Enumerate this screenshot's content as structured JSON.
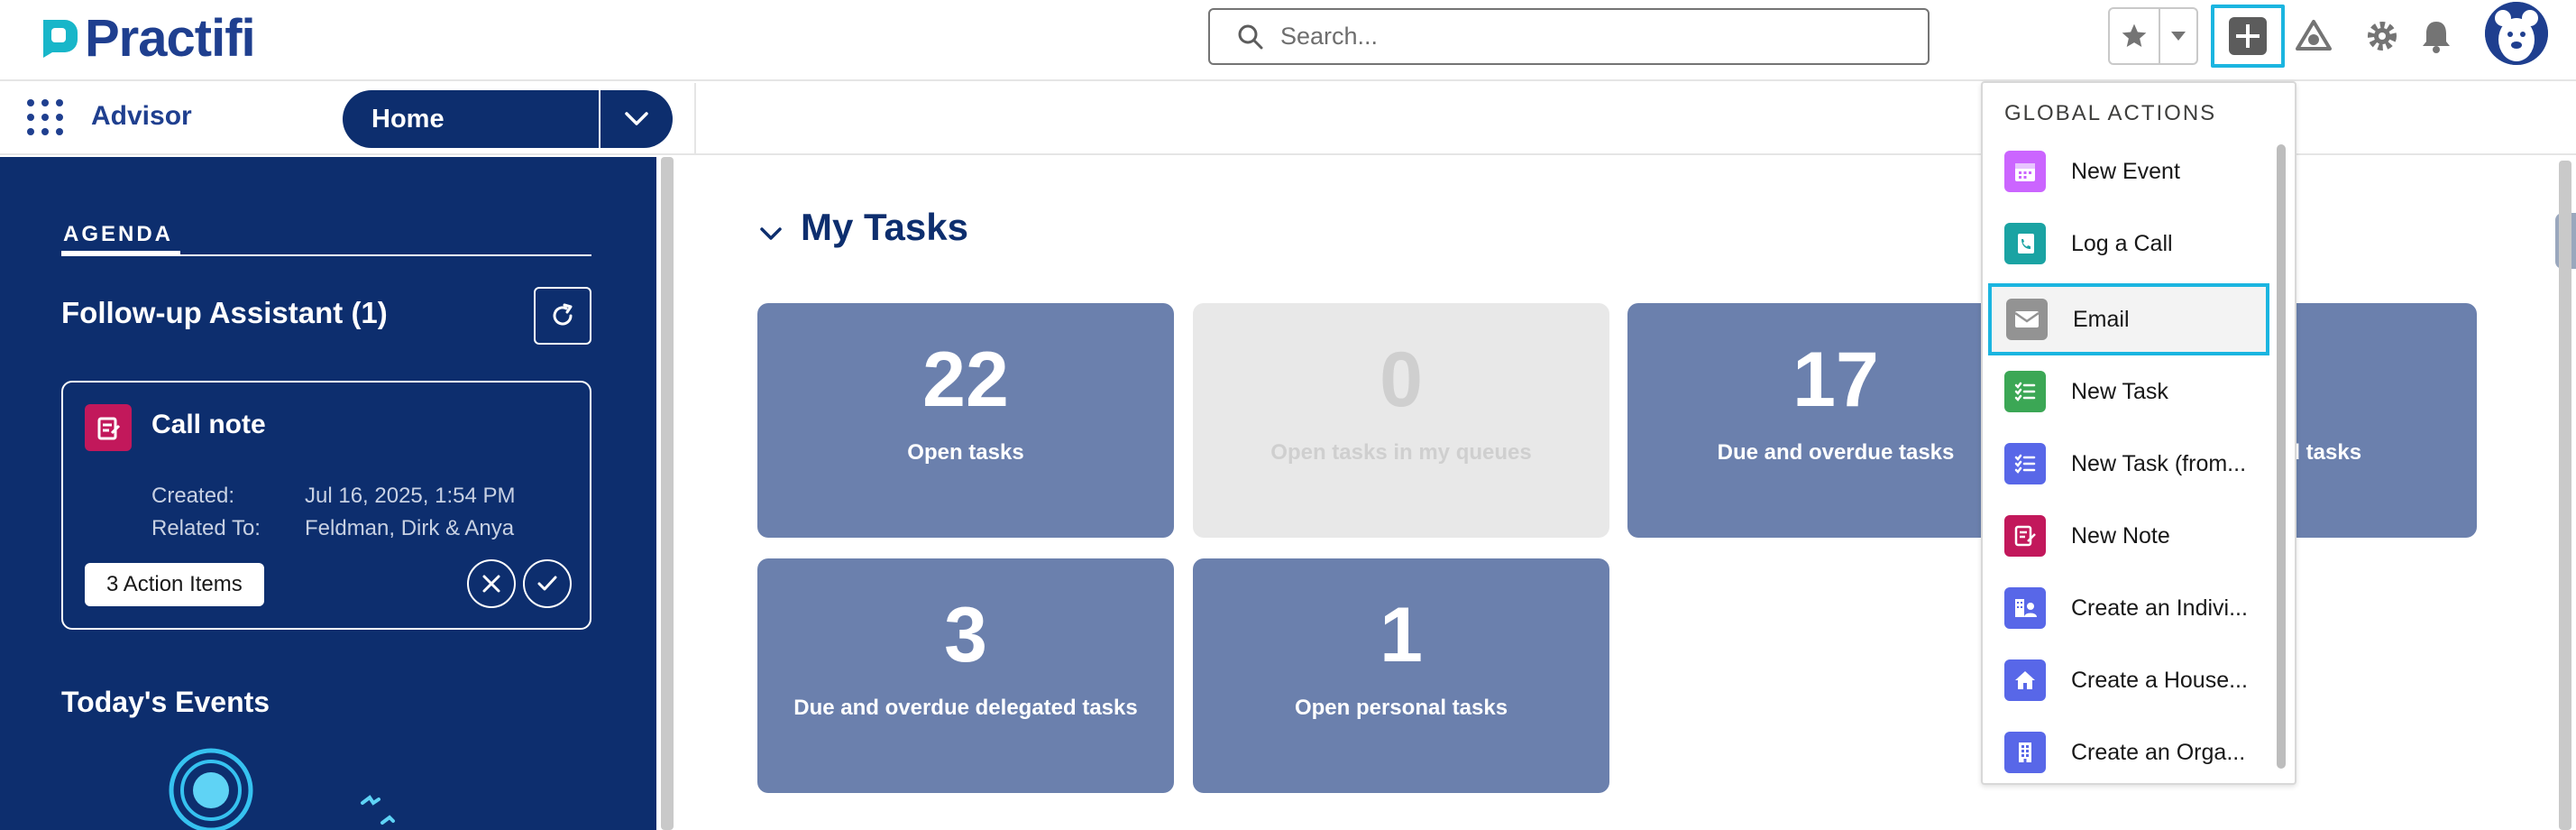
{
  "header": {
    "brand": "Practifi",
    "search_placeholder": "Search...",
    "icons": [
      "favorites-star-icon",
      "favorites-dropdown-icon",
      "global-actions-plus-icon",
      "trailhead-icon",
      "setup-gear-icon",
      "notifications-bell-icon",
      "user-avatar"
    ]
  },
  "nav": {
    "app_name": "Advisor",
    "tab_label": "Home"
  },
  "agenda": {
    "tab_label": "AGENDA",
    "followup_title": "Follow-up Assistant (1)",
    "card": {
      "title": "Call note",
      "created_label": "Created:",
      "created_value": "Jul 16, 2025, 1:54 PM",
      "related_label": "Related To:",
      "related_value": "Feldman, Dirk & Anya",
      "action_items": "3 Action Items"
    },
    "events_title": "Today's Events"
  },
  "tasks": {
    "section_title": "My Tasks",
    "tiles": [
      {
        "count": "22",
        "label": "Open tasks",
        "disabled": false
      },
      {
        "count": "0",
        "label": "Open tasks in my queues",
        "disabled": true
      },
      {
        "count": "17",
        "label": "Due and overdue tasks",
        "disabled": false
      },
      {
        "count": "",
        "label": "ed tasks",
        "disabled": false
      },
      {
        "count": "3",
        "label": "Due and overdue delegated tasks",
        "disabled": false
      },
      {
        "count": "1",
        "label": "Open personal tasks",
        "disabled": false
      }
    ]
  },
  "global_actions": {
    "header": "GLOBAL ACTIONS",
    "items": [
      {
        "label": "New Event",
        "icon": "calendar-icon",
        "color": "#cb65ff"
      },
      {
        "label": "Log a Call",
        "icon": "phone-icon",
        "color": "#1aa3a3"
      },
      {
        "label": "Email",
        "icon": "email-icon",
        "color": "#939393",
        "selected": true
      },
      {
        "label": "New Task",
        "icon": "task-icon",
        "color": "#3ba755"
      },
      {
        "label": "New Task (from...",
        "icon": "task-list-icon",
        "color": "#5867e8"
      },
      {
        "label": "New Note",
        "icon": "note-icon",
        "color": "#c2185b"
      },
      {
        "label": "Create an Indivi...",
        "icon": "individual-icon",
        "color": "#5867e8"
      },
      {
        "label": "Create a House...",
        "icon": "household-icon",
        "color": "#5867e8"
      },
      {
        "label": "Create an Orga...",
        "icon": "organization-icon",
        "color": "#5867e8"
      }
    ]
  },
  "colors": {
    "brand_navy": "#0d2e6e",
    "tile_blue": "#6b80ad",
    "focus_cyan": "#1bb5e0"
  }
}
